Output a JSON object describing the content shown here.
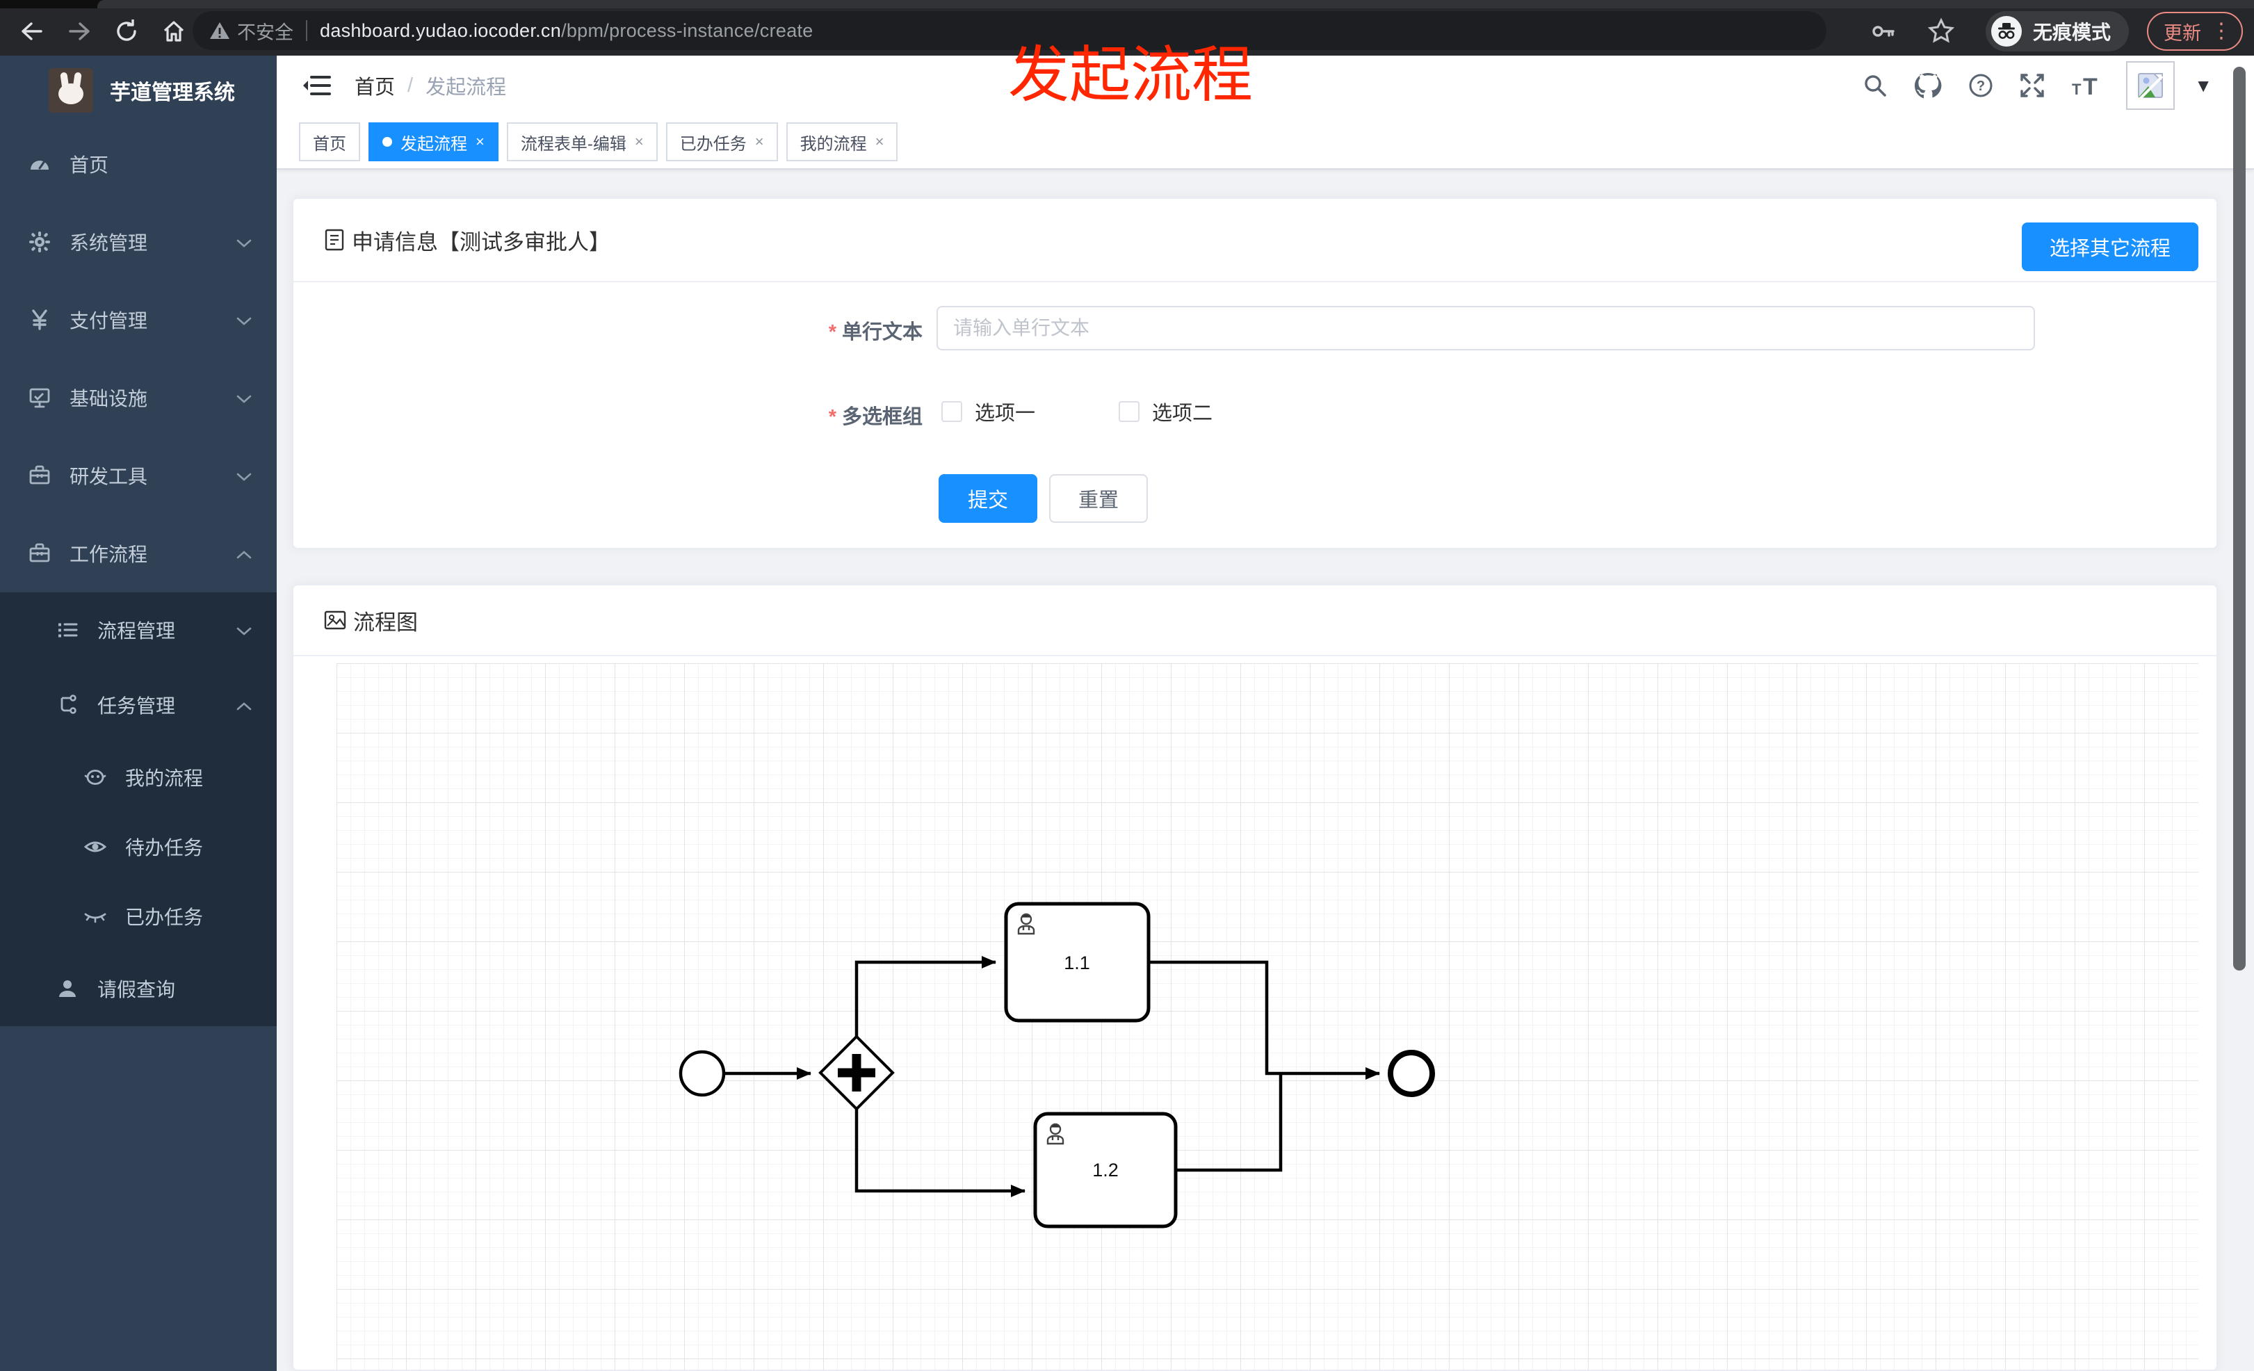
{
  "colors": {
    "accent": "#1890ff",
    "annotation_red": "#ff2600",
    "sidebar_bg": "#304156",
    "submenu_bg": "#1f2d3d"
  },
  "browser": {
    "security_label": "不安全",
    "url_domain": "dashboard.yudao.iocoder.cn",
    "url_path": "/bpm/process-instance/create",
    "incognito_label": "无痕模式",
    "update_label": "更新",
    "menu_dots": "⋮"
  },
  "annotation": {
    "text": "发起流程"
  },
  "sidebar": {
    "title": "芋道管理系统",
    "home": "首页",
    "system": "系统管理",
    "payment": "支付管理",
    "infra": "基础设施",
    "devtools": "研发工具",
    "workflow": "工作流程",
    "process_mgmt": "流程管理",
    "task_mgmt": "任务管理",
    "my_process": "我的流程",
    "todo_tasks": "待办任务",
    "done_tasks": "已办任务",
    "leave_query": "请假查询"
  },
  "header": {
    "breadcrumb_home": "首页",
    "breadcrumb_sep": "/",
    "breadcrumb_current": "发起流程"
  },
  "tabs": {
    "items": [
      {
        "label": "首页"
      },
      {
        "label": "发起流程"
      },
      {
        "label": "流程表单-编辑"
      },
      {
        "label": "已办任务"
      },
      {
        "label": "我的流程"
      }
    ],
    "close_glyph": "×"
  },
  "form_card": {
    "title": "申请信息【测试多审批人】",
    "choose_other_button": "选择其它流程",
    "fields": {
      "text_label": "单行文本",
      "text_placeholder": "请输入单行文本",
      "checkbox_label": "多选框组",
      "option1": "选项一",
      "option2": "选项二",
      "required_mark": "*"
    },
    "submit_label": "提交",
    "reset_label": "重置"
  },
  "diagram_card": {
    "title": "流程图",
    "nodes": {
      "task1": "1.1",
      "task2": "1.2"
    }
  }
}
